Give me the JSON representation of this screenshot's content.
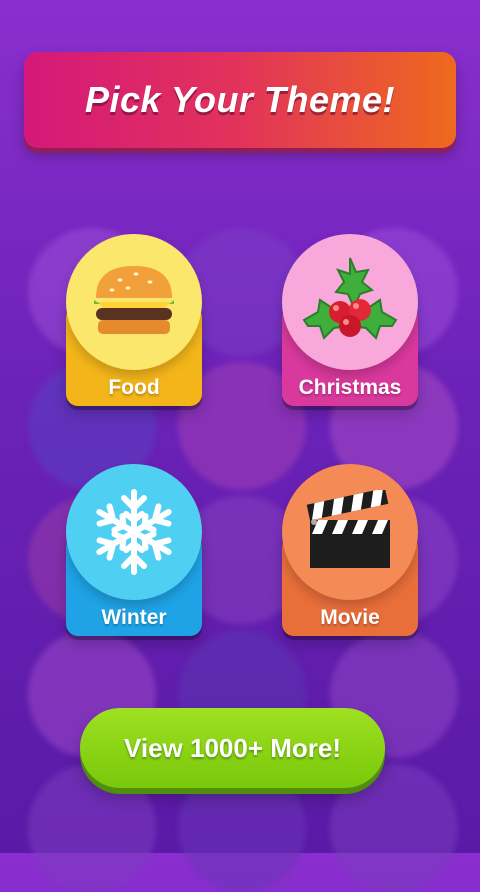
{
  "header": {
    "title": "Pick Your Theme!"
  },
  "themes": [
    {
      "label": "Food",
      "icon": "burger-icon",
      "disc_color": "#fbe76b",
      "base_color": "#f3b51a"
    },
    {
      "label": "Christmas",
      "icon": "holly-icon",
      "disc_color": "#f8a8da",
      "base_color": "#d9399c"
    },
    {
      "label": "Winter",
      "icon": "snowflake-icon",
      "disc_color": "#4fd0f2",
      "base_color": "#1fa3e6"
    },
    {
      "label": "Movie",
      "icon": "clapperboard-icon",
      "disc_color": "#f48a55",
      "base_color": "#e86e3a"
    }
  ],
  "footer": {
    "more_label": "View 1000+ More!"
  }
}
